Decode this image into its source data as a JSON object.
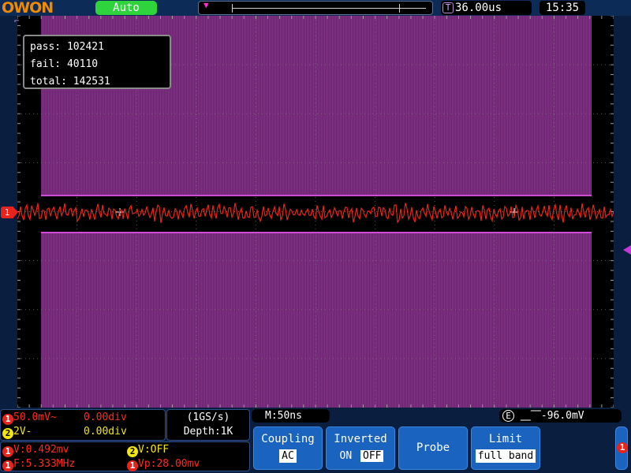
{
  "brand": {
    "logo": "OWON"
  },
  "topbar": {
    "mode": "Auto",
    "timebase": "36.00us",
    "timebase_icon": "T",
    "clock": "15:35"
  },
  "stats": {
    "pass_label": "pass:",
    "pass": "102421",
    "fail_label": "fail:",
    "fail": "40110",
    "total_label": "total:",
    "total": "142531"
  },
  "channel_marker": "1",
  "ch1": {
    "num": "1",
    "scale": "50.0mV~",
    "offset": "0.00div"
  },
  "ch2": {
    "num": "2",
    "scale": "2V-",
    "offset": "0.00div"
  },
  "acq": {
    "rate": "(1GS/s)",
    "depth": "Depth:1K"
  },
  "meas": {
    "v1": "V:0.492mv",
    "f1": "F:5.333MHz",
    "v2": "V:OFF",
    "vp": "Vp:28.00mv"
  },
  "horiz": {
    "m": "M:50ns"
  },
  "trigger": {
    "icon": "E",
    "level": "-96.0mV"
  },
  "menu": {
    "coupling_title": "Coupling",
    "coupling_value": "AC",
    "inverted_title": "Inverted",
    "inverted_on": "ON",
    "inverted_off": "OFF",
    "probe_title": "Probe",
    "limit_title": "Limit",
    "limit_value": "full band"
  },
  "scroll_indicator": "1",
  "colors": {
    "ch1": "#e8231b",
    "ch2": "#f2e510",
    "mask_band": "#8a2c91",
    "menu_blue": "#1a64c0",
    "auto_green": "#2fd43c",
    "logo_orange": "#f08a00"
  }
}
